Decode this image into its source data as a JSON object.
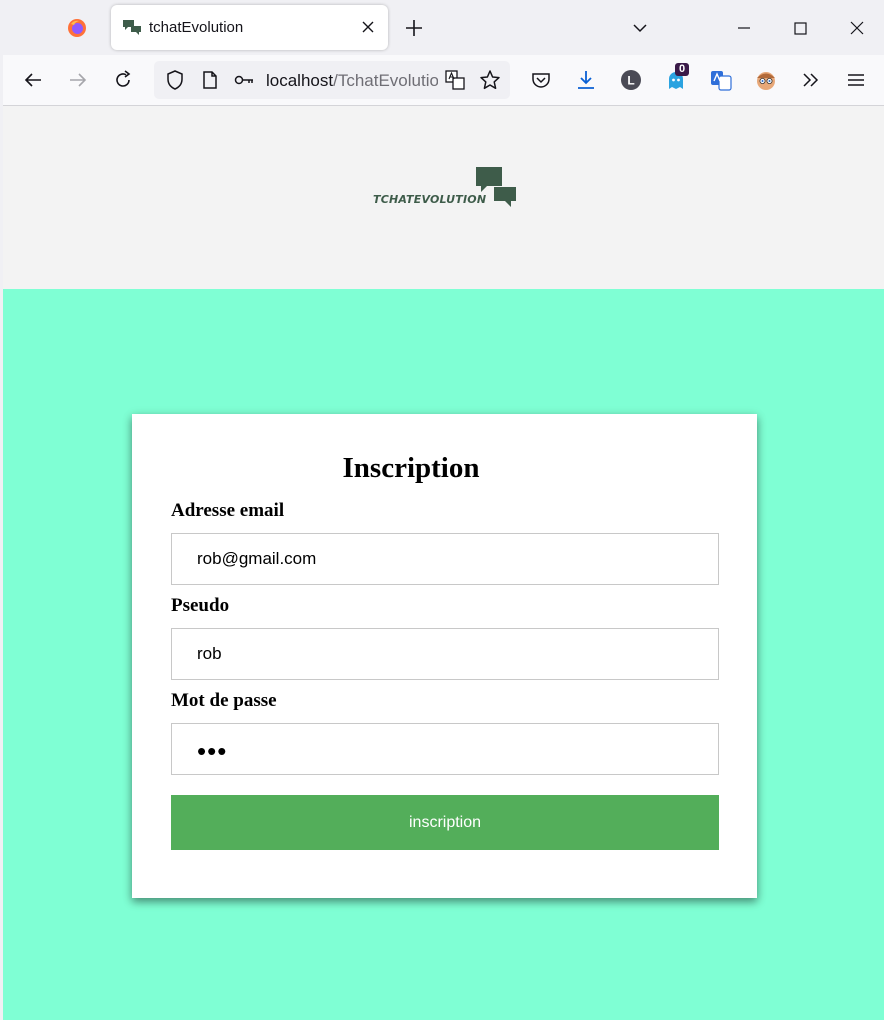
{
  "browser": {
    "tab": {
      "title": "tchatEvolution"
    },
    "url": {
      "host": "localhost",
      "path": "/TchatEvolution"
    },
    "extension_badge": "0",
    "profile_initial": "L"
  },
  "page": {
    "brand": {
      "name": "TCHATEVOLUTION"
    },
    "form": {
      "title": "Inscription",
      "email": {
        "label": "Adresse email",
        "value": "rob@gmail.com"
      },
      "pseudo": {
        "label": "Pseudo",
        "value": "rob"
      },
      "password": {
        "label": "Mot de passe",
        "value": "abc"
      },
      "submit_label": "inscription"
    }
  },
  "colors": {
    "page_background": "#7fffd4",
    "header_background": "#f3f3f3",
    "submit_button": "#53ae5a",
    "brand": "#3e5c4a"
  }
}
